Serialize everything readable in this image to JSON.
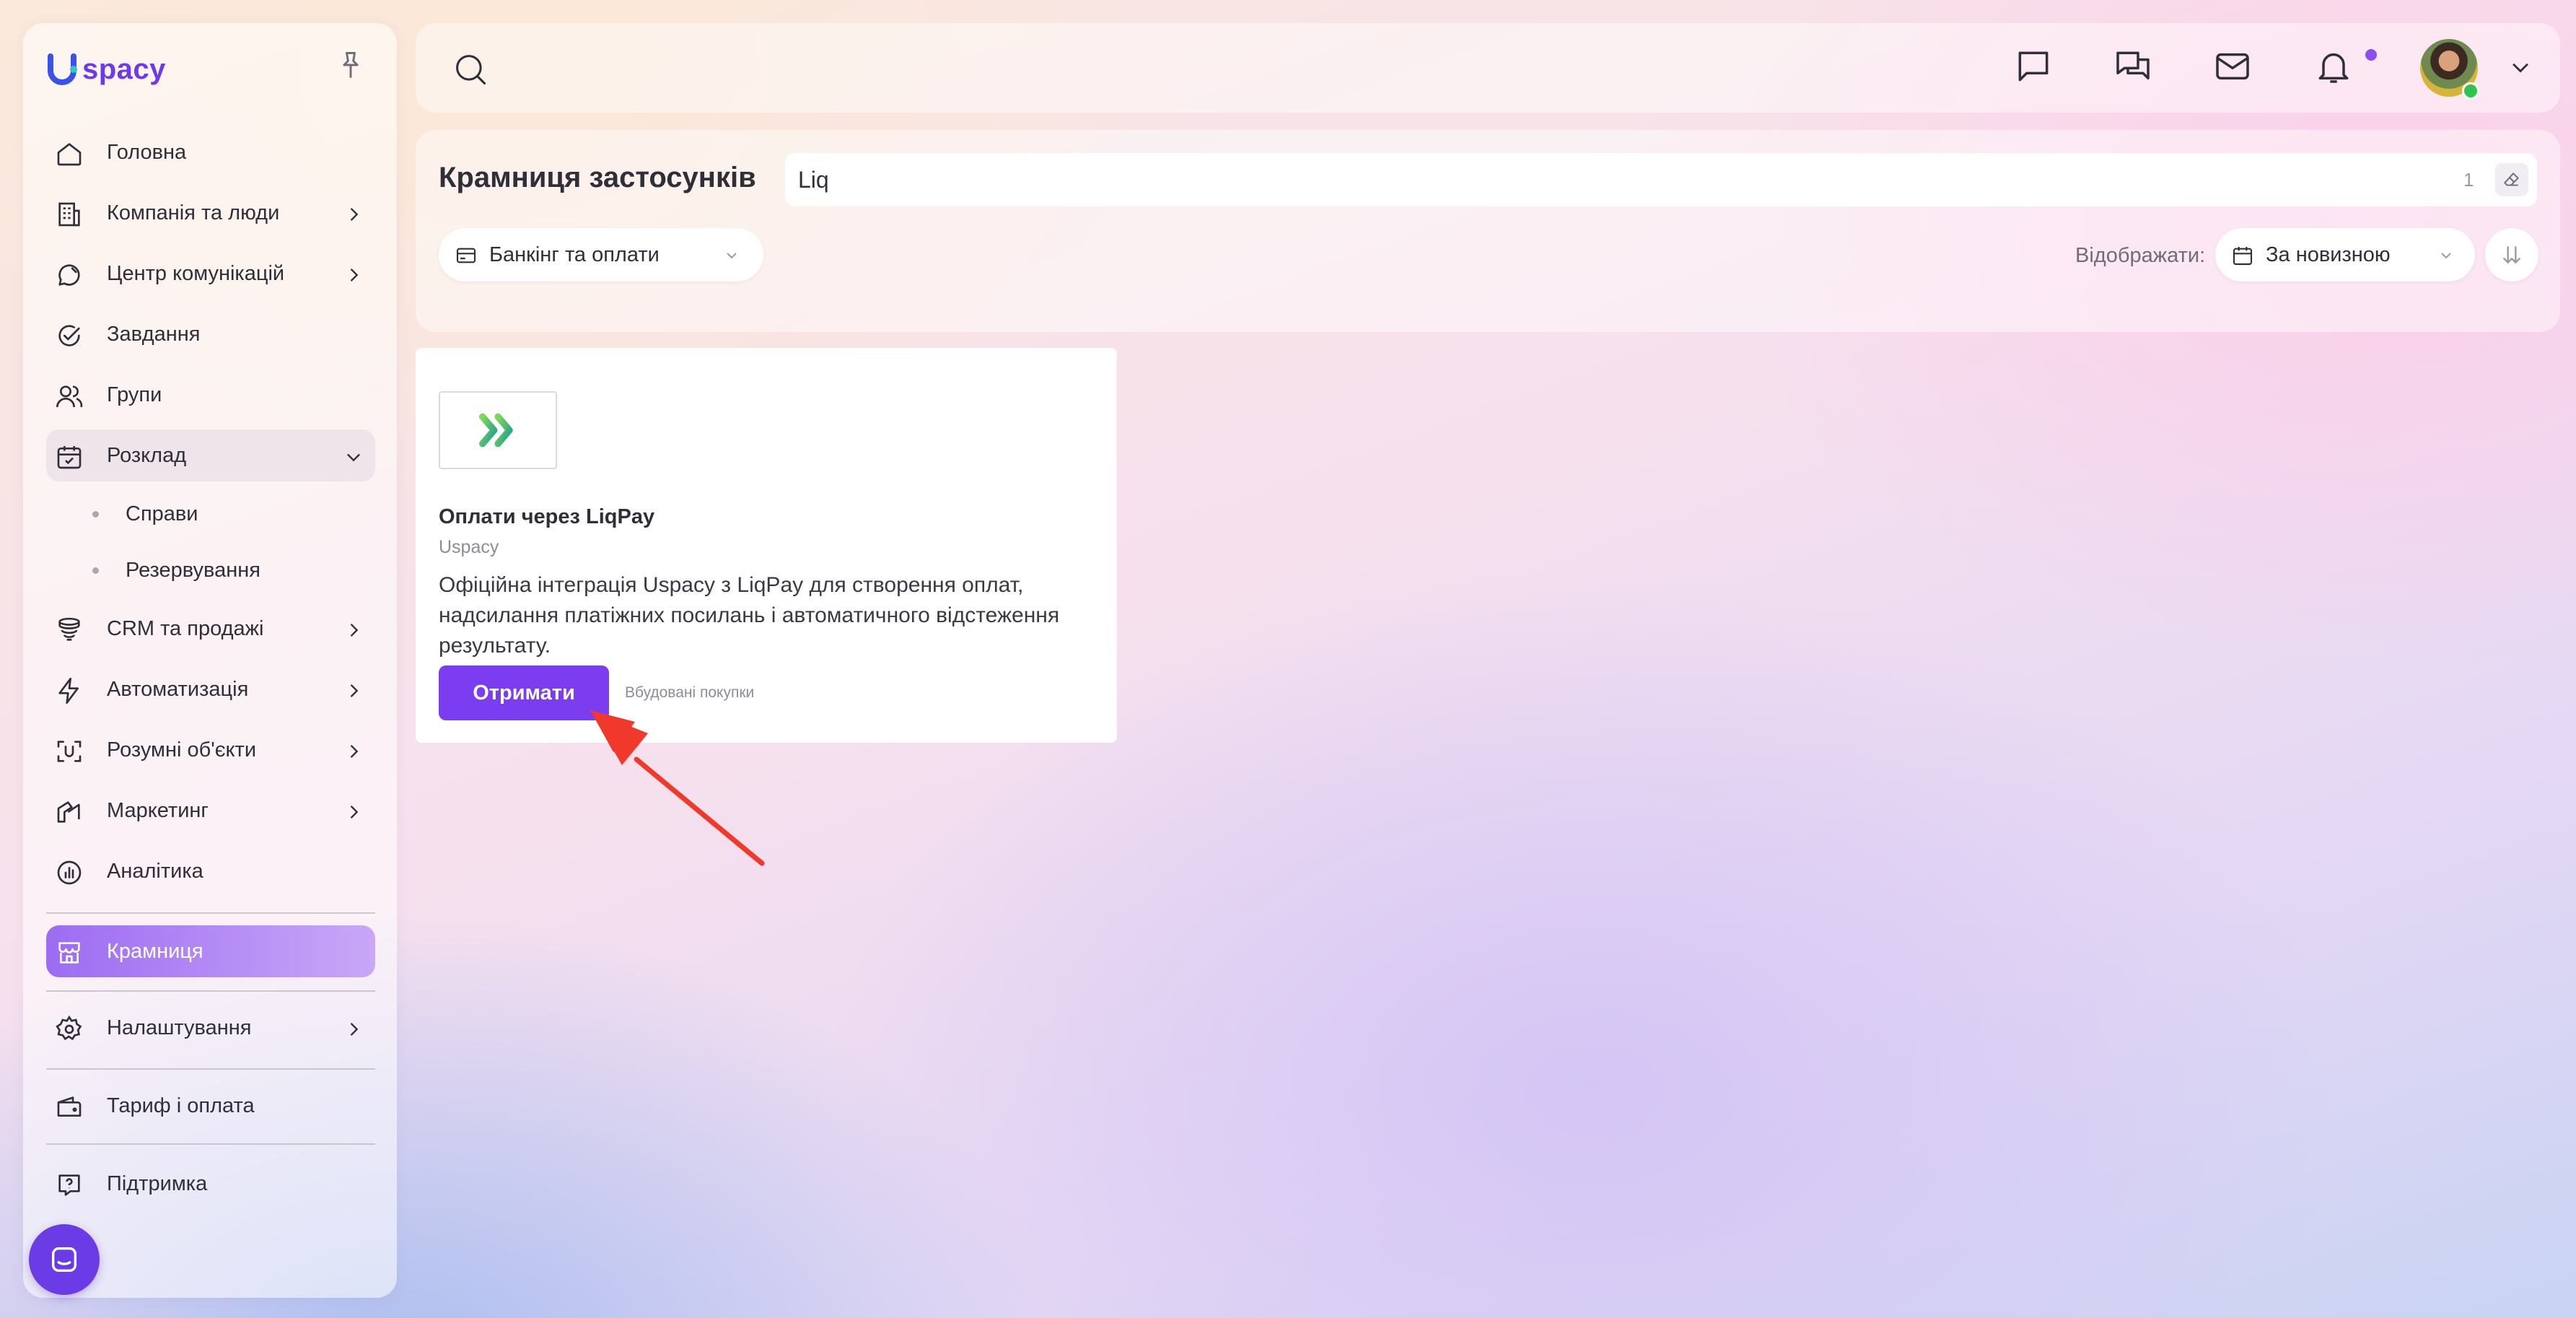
{
  "brand": {
    "name": "spacy",
    "accent": "#6d38ee"
  },
  "sidebar": {
    "items": [
      {
        "label": "Головна",
        "icon": "home-icon"
      },
      {
        "label": "Компанія та люди",
        "icon": "company-icon",
        "has_submenu": true
      },
      {
        "label": "Центр комунікацій",
        "icon": "communication-icon",
        "has_submenu": true
      },
      {
        "label": "Завдання",
        "icon": "tasks-icon"
      },
      {
        "label": "Групи",
        "icon": "groups-icon"
      },
      {
        "label": "Розклад",
        "icon": "calendar-icon",
        "expanded": true,
        "children": [
          {
            "label": "Справи"
          },
          {
            "label": "Резервування"
          }
        ]
      },
      {
        "label": "CRM та продажі",
        "icon": "crm-icon",
        "has_submenu": true
      },
      {
        "label": "Автоматизація",
        "icon": "automation-icon",
        "has_submenu": true
      },
      {
        "label": "Розумні об'єкти",
        "icon": "smart-objects-icon",
        "has_submenu": true
      },
      {
        "label": "Маркетинг",
        "icon": "marketing-icon",
        "has_submenu": true
      },
      {
        "label": "Аналітика",
        "icon": "analytics-icon"
      },
      {
        "label": "Крамниця",
        "icon": "store-icon",
        "active": true
      },
      {
        "label": "Налаштування",
        "icon": "settings-icon",
        "has_submenu": true
      },
      {
        "label": "Тариф і оплата",
        "icon": "wallet-icon"
      },
      {
        "label": "Підтримка",
        "icon": "support-icon"
      }
    ]
  },
  "topbar": {
    "icons": [
      "search-icon",
      "chat-icon",
      "group-chat-icon",
      "mail-icon",
      "bell-icon",
      "avatar",
      "chevron-down-icon"
    ],
    "notification_dot_color": "#8b4df2"
  },
  "store": {
    "title": "Крамниця застосунків",
    "search_value": "Liq",
    "search_count": "1",
    "category_filter": "Банкінг та оплати",
    "show_label": "Відображати:",
    "sort_option": "За новизною"
  },
  "apps": [
    {
      "name": "Оплати через LiqPay",
      "vendor": "Uspacy",
      "description": "Офіційна інтеграція Uspacy з LiqPay для створення оплат, надсилання платіжних посилань і автоматичного відстеження результату.",
      "button_label": "Отримати",
      "tag": "Вбудовані покупки",
      "button_color": "#7c3cf0"
    }
  ]
}
